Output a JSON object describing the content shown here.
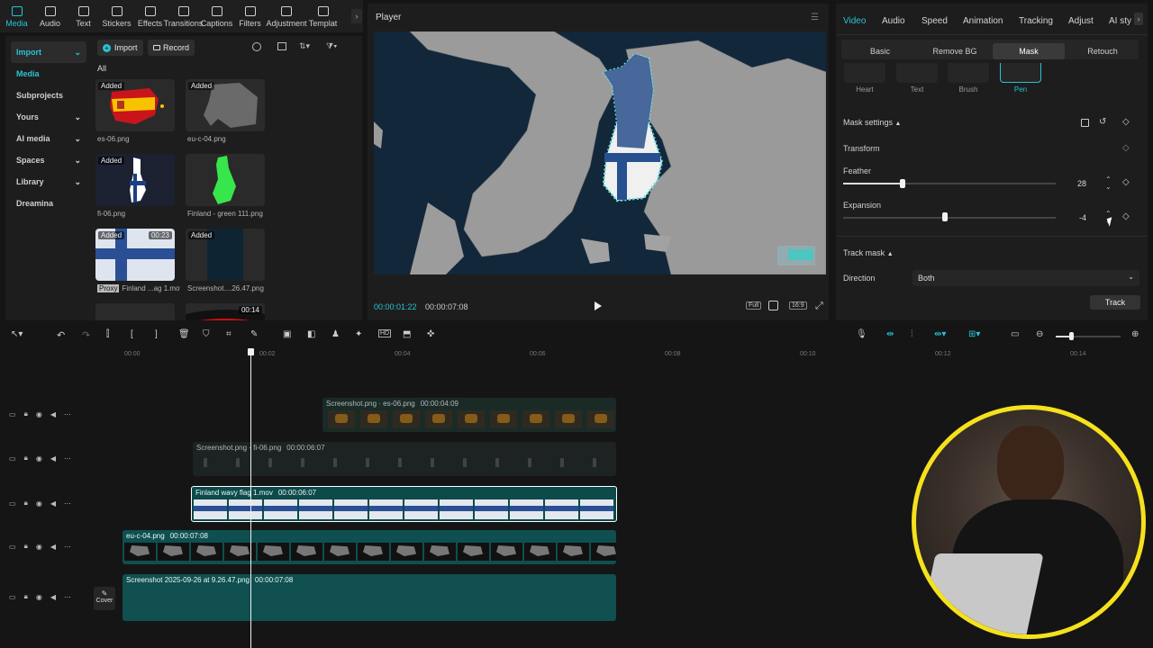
{
  "top_tools": [
    {
      "label": "Media",
      "icon": "media-icon",
      "active": true
    },
    {
      "label": "Audio",
      "icon": "audio-icon"
    },
    {
      "label": "Text",
      "icon": "text-icon"
    },
    {
      "label": "Stickers",
      "icon": "stickers-icon"
    },
    {
      "label": "Effects",
      "icon": "effects-icon"
    },
    {
      "label": "Transitions",
      "icon": "transitions-icon"
    },
    {
      "label": "Captions",
      "icon": "captions-icon"
    },
    {
      "label": "Filters",
      "icon": "filters-icon"
    },
    {
      "label": "Adjustment",
      "icon": "adjustment-icon"
    },
    {
      "label": "Templat",
      "icon": "templates-icon"
    }
  ],
  "left_nav": [
    {
      "label": "Import",
      "caret": true,
      "state": "sel"
    },
    {
      "label": "Media",
      "caret": false,
      "state": "active"
    },
    {
      "label": "Subprojects",
      "caret": false,
      "state": ""
    },
    {
      "label": "Yours",
      "caret": true,
      "state": ""
    },
    {
      "label": "AI media",
      "caret": true,
      "state": ""
    },
    {
      "label": "Spaces",
      "caret": true,
      "state": ""
    },
    {
      "label": "Library",
      "caret": true,
      "state": ""
    },
    {
      "label": "Dreamina",
      "caret": false,
      "state": ""
    }
  ],
  "media_toolbar": {
    "import": "Import",
    "record": "Record"
  },
  "media_filter": "All",
  "media_items": [
    {
      "name": "es-06.png",
      "tag": "Added",
      "kind": "spain"
    },
    {
      "name": "eu-c-04.png",
      "tag": "Added",
      "kind": "europe"
    },
    {
      "name": "fi-06.png",
      "tag": "Added",
      "kind": "fi-shape"
    },
    {
      "name": "Finland - green 111.png",
      "tag": "",
      "kind": "fi-green"
    },
    {
      "name": "Finland ...ag 1.mov",
      "tag": "Added",
      "kind": "fi-flag",
      "proxy": "Proxy",
      "duration": "00:23"
    },
    {
      "name": "Screenshot....26.47.png",
      "tag": "Added",
      "kind": "screenshot"
    },
    {
      "name": "",
      "tag": "",
      "kind": "blank"
    },
    {
      "name": "",
      "tag": "",
      "kind": "germany",
      "duration": "00:14"
    }
  ],
  "player": {
    "title": "Player",
    "current_time": "00:00:01:22",
    "total_time": "00:00:07:08",
    "full_label": "Full",
    "ratio_label": "16:9"
  },
  "right_tabs": [
    "Video",
    "Audio",
    "Speed",
    "Animation",
    "Tracking",
    "Adjust",
    "AI sty"
  ],
  "sub_tabs": [
    "Basic",
    "Remove BG",
    "Mask",
    "Retouch"
  ],
  "mask_shapes": [
    "Heart",
    "Text",
    "Brush",
    "Pen"
  ],
  "mask": {
    "settings_label": "Mask settings",
    "transform_label": "Transform",
    "feather_label": "Feather",
    "feather_value": "28",
    "feather_level": 0.28,
    "expansion_label": "Expansion",
    "expansion_value": "-4",
    "expansion_level": 0.48,
    "track_mask_label": "Track mask",
    "direction_label": "Direction",
    "direction_value": "Both",
    "track_button": "Track"
  },
  "ruler": [
    "00:00",
    "00:02",
    "00:04",
    "00:06",
    "00:08",
    "00:10",
    "00:12",
    "00:14"
  ],
  "tracks": [
    {
      "name": "Screenshot.png · es-06.png",
      "duration": "00:00:04:09",
      "faded": true
    },
    {
      "name": "Screenshot.png · fi-06.png",
      "duration": "00:00:06:07",
      "faded": true
    },
    {
      "name": "Finland wavy flag 1.mov",
      "duration": "00:00:06:07",
      "faded": false
    },
    {
      "name": "eu-c-04.png",
      "duration": "00:00:07:08",
      "faded": false
    },
    {
      "name": "Screenshot 2025-09-26 at 9.26.47.png",
      "duration": "00:00:07:08",
      "faded": false
    }
  ],
  "cover_label": "Cover",
  "colors": {
    "accent": "#28c3d4",
    "webcam_ring": "#f5e11c",
    "clip_teal": "#0f4f4f"
  }
}
